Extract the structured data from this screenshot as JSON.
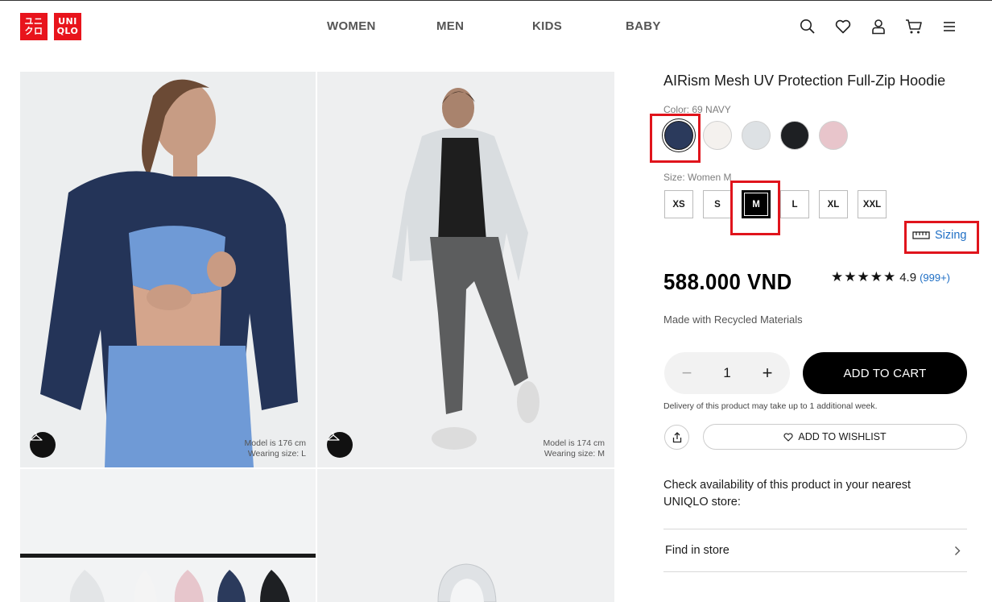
{
  "brand": {
    "logo_top": [
      "ユニ",
      "クロ"
    ],
    "logo_en": [
      "UNI",
      "QLO"
    ]
  },
  "nav": [
    "WOMEN",
    "MEN",
    "KIDS",
    "BABY"
  ],
  "header_icons": [
    "search-icon",
    "heart-icon",
    "user-icon",
    "cart-icon",
    "menu-icon"
  ],
  "gallery": {
    "photos": [
      {
        "model": "Model is 176 cm",
        "wearing": "Wearing size: L"
      },
      {
        "model": "Model is 174 cm",
        "wearing": "Wearing size: M"
      }
    ]
  },
  "product": {
    "title": "AIRism Mesh UV Protection Full-Zip Hoodie",
    "color_label": "Color: 69 NAVY",
    "colors": [
      {
        "name": "69 NAVY",
        "hex": "#2b3a5c",
        "selected": true
      },
      {
        "name": "off white",
        "hex": "#f4f1ee",
        "selected": false
      },
      {
        "name": "light gray",
        "hex": "#dde1e4",
        "selected": false
      },
      {
        "name": "black",
        "hex": "#1e2023",
        "selected": false
      },
      {
        "name": "pink",
        "hex": "#e8c5cb",
        "selected": false
      }
    ],
    "size_label": "Size: Women M",
    "sizes": [
      "XS",
      "S",
      "M",
      "L",
      "XL",
      "XXL"
    ],
    "selected_size": "M",
    "sizing_link": "Sizing",
    "price": "588.000 VND",
    "rating": {
      "stars": "★★★★★",
      "value": "4.9",
      "count": "(999+)"
    },
    "made_with": "Made with Recycled Materials",
    "quantity": "1",
    "add_to_cart": "ADD TO CART",
    "delivery_note": "Delivery of this product may take up to 1 additional week.",
    "add_to_wishlist": "ADD TO WISHLIST",
    "store_check": "Check availability of this product in your nearest UNIQLO store:",
    "find_in_store": "Find in store"
  },
  "colors": {
    "accent_red": "#e0141c",
    "link_blue": "#1f6fc5",
    "brand_red": "#e8141c"
  }
}
